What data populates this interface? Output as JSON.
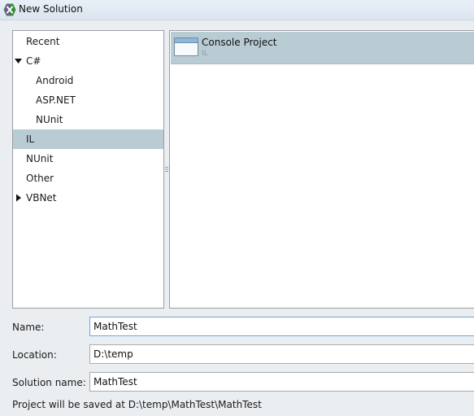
{
  "window": {
    "title": "New Solution",
    "icon": "xamarin-logo-icon"
  },
  "categories": [
    {
      "label": "Recent",
      "expander": null,
      "selected": false
    },
    {
      "label": "C#",
      "expander": "expanded",
      "selected": false
    },
    {
      "label": "Android",
      "expander": null,
      "selected": false
    },
    {
      "label": "ASP.NET",
      "expander": null,
      "selected": false
    },
    {
      "label": "NUnit",
      "expander": null,
      "selected": false
    },
    {
      "label": "IL",
      "expander": null,
      "selected": true
    },
    {
      "label": "NUnit",
      "expander": null,
      "selected": false
    },
    {
      "label": "Other",
      "expander": null,
      "selected": false
    },
    {
      "label": "VBNet",
      "expander": "collapsed",
      "selected": false
    }
  ],
  "templates": [
    {
      "name": "Console Project",
      "language": "IL",
      "icon": "console-window-icon",
      "selected": true
    }
  ],
  "form": {
    "name_label": "Name:",
    "name_value": "MathTest",
    "location_label": "Location:",
    "location_value": "D:\\temp",
    "solution_label": "Solution name:",
    "solution_value": "MathTest"
  },
  "save_path_text": "Project will be saved at D:\\temp\\MathTest\\MathTest",
  "colors": {
    "selection": "#b9ccd3",
    "background": "#eaeef1",
    "focus_border": "#6fa7d9"
  }
}
